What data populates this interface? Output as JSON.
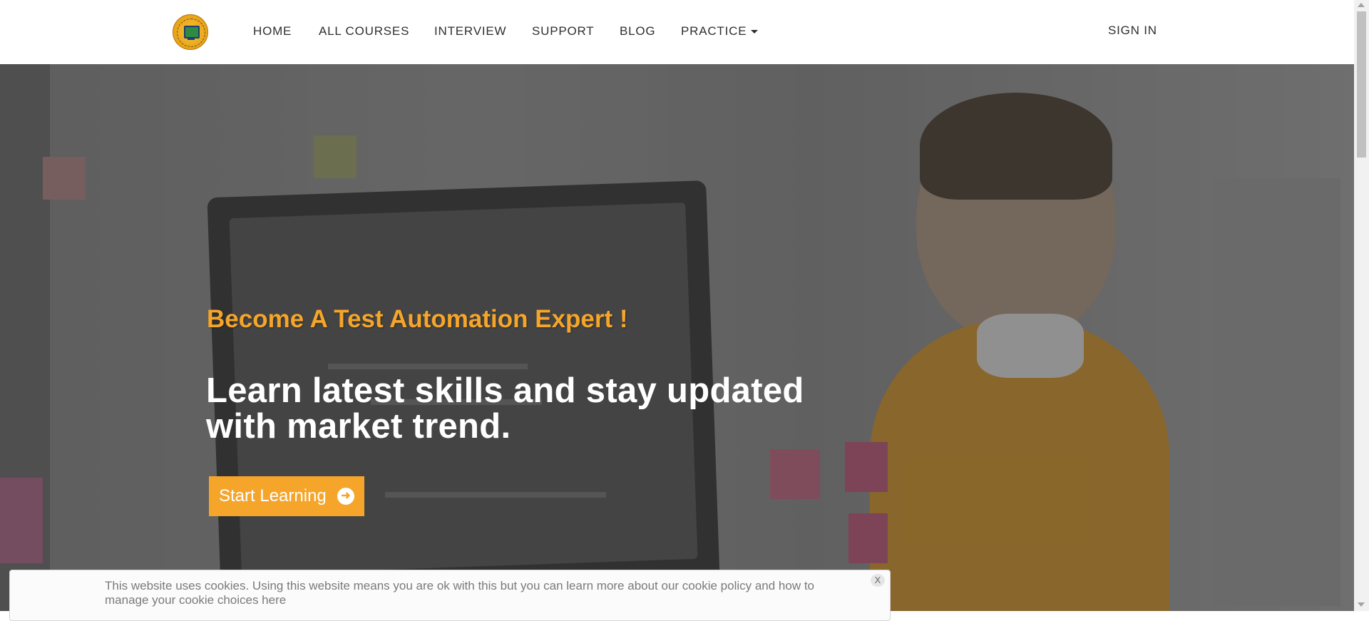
{
  "nav": {
    "items": [
      {
        "label": "HOME"
      },
      {
        "label": "ALL COURSES"
      },
      {
        "label": "INTERVIEW"
      },
      {
        "label": "SUPPORT"
      },
      {
        "label": "BLOG"
      },
      {
        "label": "PRACTICE"
      }
    ],
    "signin_label": "SIGN IN"
  },
  "hero": {
    "subtitle": "Become A Test Automation Expert !",
    "title": "Learn latest skills and stay updated with market trend.",
    "cta_label": "Start Learning",
    "cta_icon": "arrow-circle-right-icon"
  },
  "cookie": {
    "text": "This website uses cookies. Using this website means you are ok with this but you can learn more about our cookie policy and how to manage your cookie choices here",
    "close_label": "X"
  },
  "colors": {
    "accent": "#f5a52a",
    "header_bg": "#ffffff",
    "nav_text": "#2f2f2f"
  }
}
